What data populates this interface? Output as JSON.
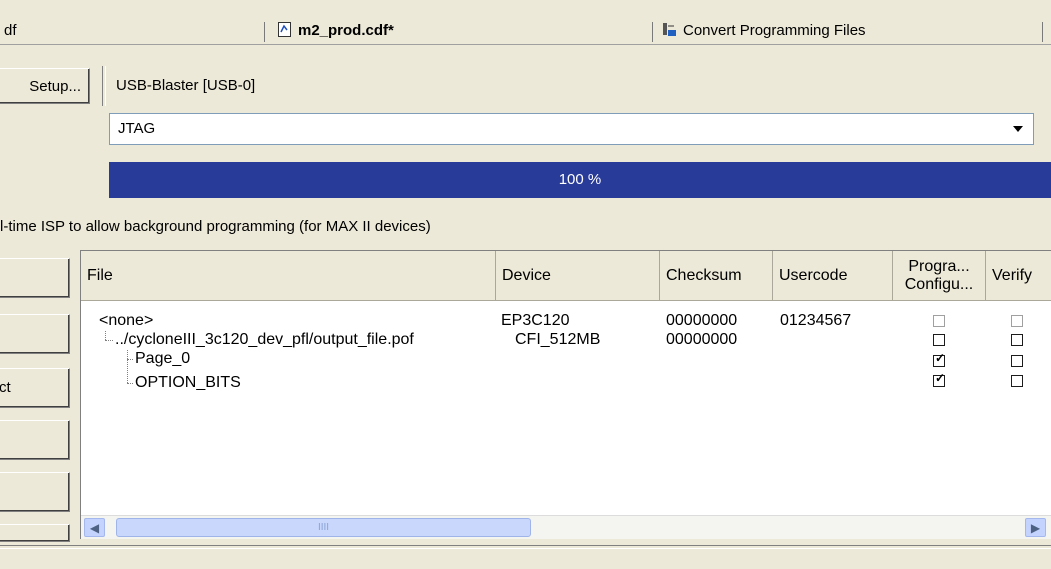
{
  "tabs": [
    {
      "label": "df",
      "active": false
    },
    {
      "label": "m2_prod.cdf*",
      "active": true,
      "icon": "document-icon"
    },
    {
      "label": "Convert Programming Files",
      "active": false,
      "icon": "convert-icon"
    }
  ],
  "hardware": {
    "setup_label": "Setup...",
    "value": "USB-Blaster [USB-0]"
  },
  "mode": {
    "value": "JTAG",
    "arrow_icon": "chevron-down-icon"
  },
  "progress": {
    "label": "100 %",
    "fraction": 1.0,
    "color": "#283b99"
  },
  "isp_text": "l-time ISP to allow background programming (for MAX II devices)",
  "side_buttons": [
    {
      "label": ""
    },
    {
      "label": ""
    },
    {
      "label": "ct"
    },
    {
      "label": ""
    },
    {
      "label": ""
    }
  ],
  "table": {
    "columns": [
      "File",
      "Device",
      "Checksum",
      "Usercode",
      "Progra... Configu...",
      "Verify"
    ],
    "col_program_line1": "Progra...",
    "col_program_line2": "Configu...",
    "rows": [
      {
        "file": "<none>",
        "device": "EP3C120",
        "checksum": "00000000",
        "usercode": "01234567",
        "program": false,
        "program_enabled": false,
        "verify": false,
        "verify_enabled": false
      },
      {
        "file": "../cycloneIII_3c120_dev_pfl/output_file.pof",
        "device": "CFI_512MB",
        "checksum": "00000000",
        "usercode": "",
        "program": false,
        "program_enabled": true,
        "verify": false,
        "verify_enabled": true
      },
      {
        "file": "Page_0",
        "device": "",
        "checksum": "",
        "usercode": "",
        "program": true,
        "program_enabled": true,
        "verify": false,
        "verify_enabled": true
      },
      {
        "file": "OPTION_BITS",
        "device": "",
        "checksum": "",
        "usercode": "",
        "program": true,
        "program_enabled": true,
        "verify": false,
        "verify_enabled": true
      }
    ]
  },
  "scroll": {
    "thumb_grip": "IIII"
  }
}
